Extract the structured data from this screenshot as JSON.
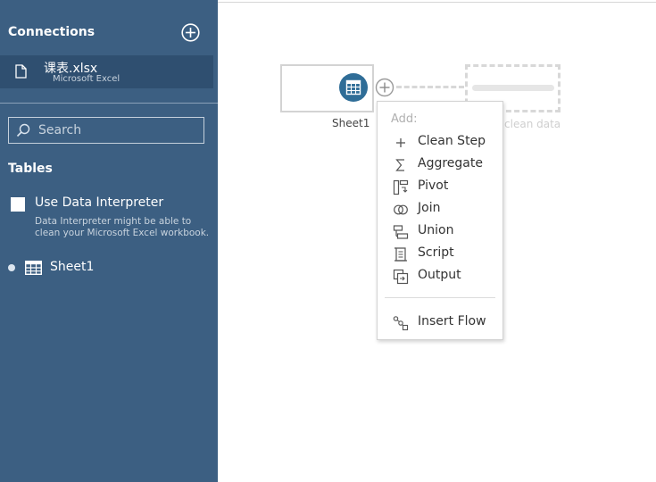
{
  "sidebar": {
    "connections_title": "Connections",
    "connection": {
      "name": "课表.xlsx",
      "type": "Microsoft Excel"
    },
    "search": {
      "placeholder": "Search",
      "value": ""
    },
    "tables_title": "Tables",
    "data_interpreter": {
      "label": "Use Data Interpreter",
      "help": "Data Interpreter might be able to clean your Microsoft Excel workbook.",
      "checked": false
    },
    "tables": [
      {
        "name": "Sheet1"
      }
    ]
  },
  "canvas": {
    "input_node_label": "Sheet1",
    "ghost_label": "Add clean data"
  },
  "menu": {
    "header": "Add:",
    "items": [
      {
        "label": "Clean Step",
        "icon": "plus-icon"
      },
      {
        "label": "Aggregate",
        "icon": "sigma-icon"
      },
      {
        "label": "Pivot",
        "icon": "pivot-icon"
      },
      {
        "label": "Join",
        "icon": "join-icon"
      },
      {
        "label": "Union",
        "icon": "union-icon"
      },
      {
        "label": "Script",
        "icon": "script-icon"
      },
      {
        "label": "Output",
        "icon": "output-icon"
      }
    ],
    "insert_flow": {
      "label": "Insert Flow",
      "icon": "insert-flow-icon"
    }
  },
  "colors": {
    "sidebar_bg": "#3c5f82",
    "selected_connection_bg": "#2f4f70",
    "node_badge": "#2f6d97"
  }
}
